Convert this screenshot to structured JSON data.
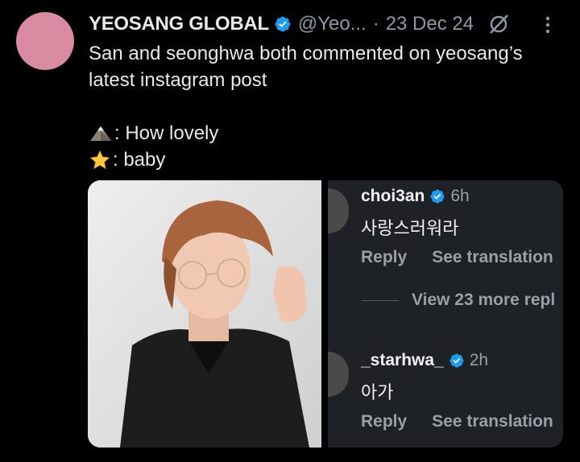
{
  "header": {
    "account_name": "YEOSANG GLOBAL",
    "handle": "@Yeo...",
    "separator": "·",
    "date": "23 Dec 24"
  },
  "tweet": {
    "line1": "San and seonghwa both commented on yeosang’s",
    "line2": "latest instagram post",
    "quote1_icon": "mountain-icon",
    "quote1": ": How lovely",
    "quote2_icon": "star-icon",
    "quote2": ": baby"
  },
  "comments": [
    {
      "username": "choi3an",
      "time": "6h",
      "text": "사랑스러워라",
      "reply": "Reply",
      "translate": "See translation"
    },
    {
      "username": "_starhwa_",
      "time": "2h",
      "text": "아가",
      "reply": "Reply",
      "translate": "See translation"
    }
  ],
  "view_more": "View 23 more repl",
  "colors": {
    "background": "#000000",
    "verified": "#1d9bf0",
    "text": "#e7e9ea",
    "muted": "#8b98a5",
    "avatar": "#d98ba2",
    "comment_panel": "#1e2125"
  }
}
